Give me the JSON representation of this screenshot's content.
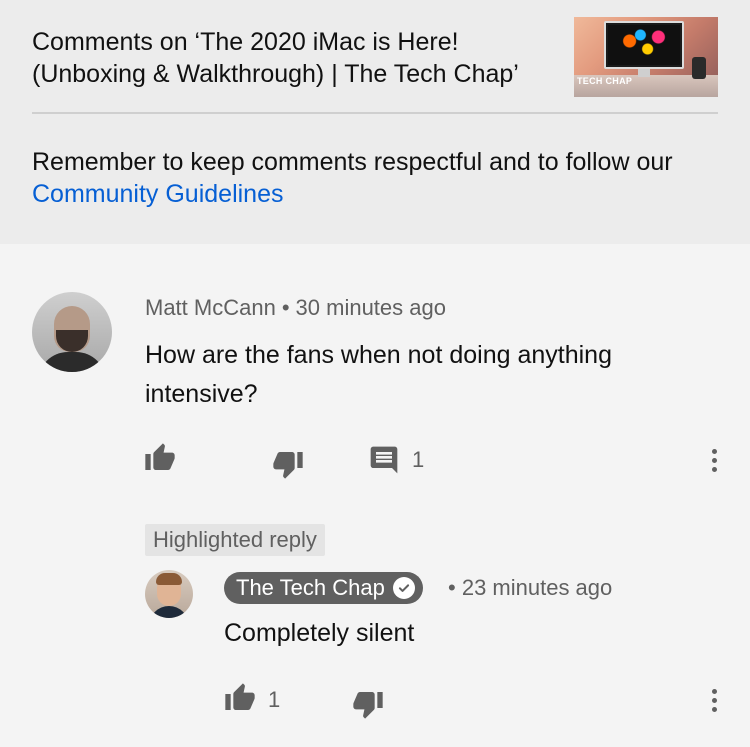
{
  "header": {
    "title": "Comments on ‘The 2020 iMac is Here! (Unboxing & Walkthrough) | The Tech Chap’",
    "thumbnail_brand": "TECH CHAP",
    "notice_prefix": "Remember to keep comments respectful and to follow our ",
    "notice_link": "Community Guidelines"
  },
  "comment": {
    "author": "Matt McCann",
    "separator": "•",
    "time": "30 minutes ago",
    "text": "How are the fans when not doing anything intensive?",
    "reply_count": "1",
    "icons": {
      "like": "thumb-up-icon",
      "dislike": "thumb-down-icon",
      "reply": "comment-icon",
      "more": "more-vert-icon"
    }
  },
  "reply": {
    "highlight_label": "Highlighted reply",
    "author": "The Tech Chap",
    "separator": "•",
    "time": "23 minutes ago",
    "text": "Completely silent",
    "like_count": "1",
    "icons": {
      "verified": "verified-check-icon",
      "like": "thumb-up-icon",
      "dislike": "thumb-down-icon",
      "more": "more-vert-icon"
    }
  },
  "colors": {
    "link": "#065fd4",
    "secondary_text": "#606060",
    "header_bg": "#ececec",
    "body_bg": "#f4f4f4",
    "author_chip_bg": "#606060"
  }
}
